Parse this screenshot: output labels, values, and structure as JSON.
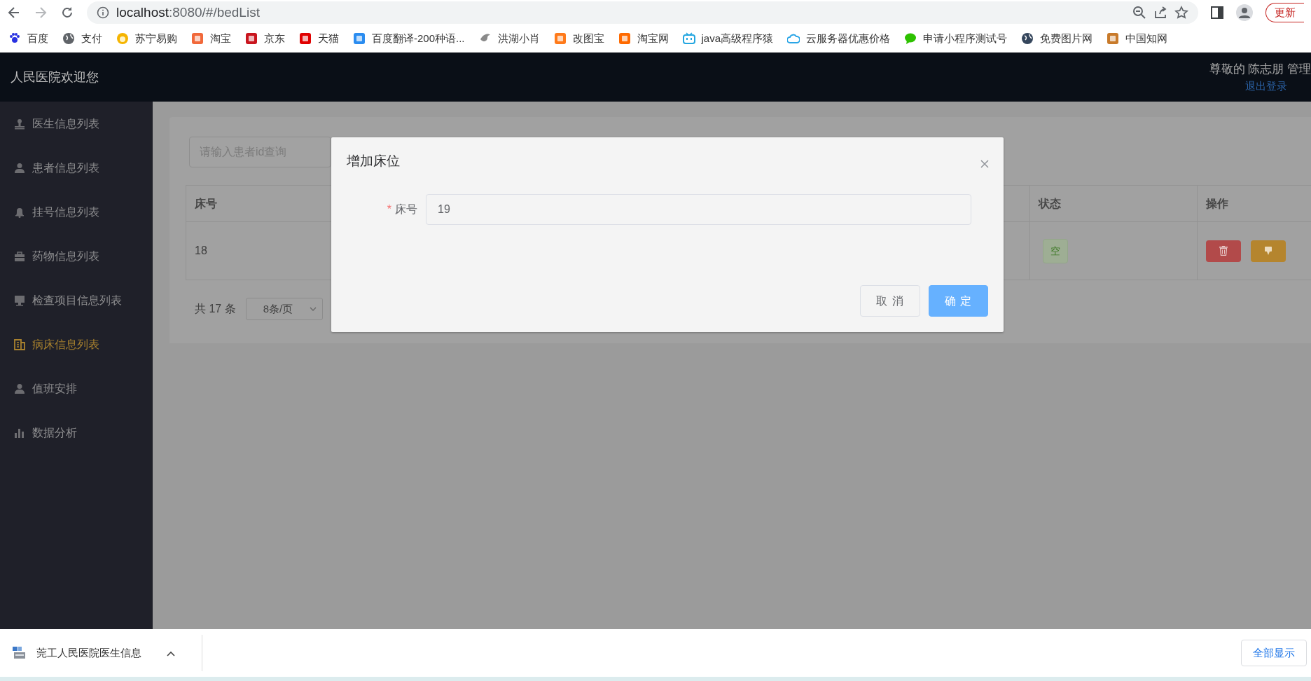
{
  "browser": {
    "url_host": "localhost",
    "url_path": ":8080/#/bedList",
    "update_button": "更新"
  },
  "bookmarks": [
    {
      "label": "百度",
      "kind": "paw",
      "color": "#2932e1"
    },
    {
      "label": "支付",
      "kind": "globe",
      "color": "#5f6368"
    },
    {
      "label": "苏宁易购",
      "kind": "sun",
      "color": "#f5b400"
    },
    {
      "label": "淘宝",
      "kind": "tile",
      "color": "#f1683a"
    },
    {
      "label": "京东",
      "kind": "tile",
      "color": "#c9151e"
    },
    {
      "label": "天猫",
      "kind": "tile",
      "color": "#e00000"
    },
    {
      "label": "百度翻译-200种语...",
      "kind": "tile",
      "color": "#2a8cf0"
    },
    {
      "label": "洪湖小肖",
      "kind": "bird",
      "color": "#8a8a8a"
    },
    {
      "label": "改图宝",
      "kind": "tile",
      "color": "#ff7a1a"
    },
    {
      "label": "淘宝网",
      "kind": "tile",
      "color": "#ff6a00"
    },
    {
      "label": "java高级程序猿",
      "kind": "tv",
      "color": "#23a6e0"
    },
    {
      "label": "云服务器优惠价格",
      "kind": "cloud",
      "color": "#2aa5e6"
    },
    {
      "label": "申请小程序测试号",
      "kind": "chat",
      "color": "#2dc100"
    },
    {
      "label": "免费图片网",
      "kind": "globe",
      "color": "#35465c"
    },
    {
      "label": "中国知网",
      "kind": "tile",
      "color": "#c87a2a"
    }
  ],
  "app": {
    "title": "人民医院欢迎您",
    "greeting": "尊敬的 陈志朋 管理",
    "logout": "退出登录"
  },
  "sidebar": {
    "items": [
      {
        "label": "医生信息列表",
        "kind": "stamp",
        "selected": false
      },
      {
        "label": "患者信息列表",
        "kind": "person",
        "selected": false
      },
      {
        "label": "挂号信息列表",
        "kind": "bell",
        "selected": false
      },
      {
        "label": "药物信息列表",
        "kind": "case",
        "selected": false
      },
      {
        "label": "检查项目信息列表",
        "kind": "monitor",
        "selected": false
      },
      {
        "label": "病床信息列表",
        "kind": "building",
        "selected": true
      },
      {
        "label": "值班安排",
        "kind": "person",
        "selected": false
      },
      {
        "label": "数据分析",
        "kind": "bars",
        "selected": false
      }
    ]
  },
  "search": {
    "placeholder": "请输入患者id查询"
  },
  "table": {
    "columns": [
      "床号",
      "状态",
      "操作"
    ],
    "rows": [
      {
        "bed": "18",
        "status": "空",
        "actions": [
          {
            "kind": "delete"
          },
          {
            "kind": "edit"
          }
        ]
      }
    ]
  },
  "pagination": {
    "total": "共 17 条",
    "page_size": "8条/页"
  },
  "dialog": {
    "title": "增加床位",
    "field": {
      "required_mark": "*",
      "label": "床号",
      "value": "19"
    },
    "buttons": [
      {
        "label": "取 消",
        "kind": "default"
      },
      {
        "label": "确 定",
        "kind": "primary"
      }
    ]
  },
  "download_bar": {
    "item": "莞工人民医院医生信息",
    "show_all": "全部显示"
  }
}
